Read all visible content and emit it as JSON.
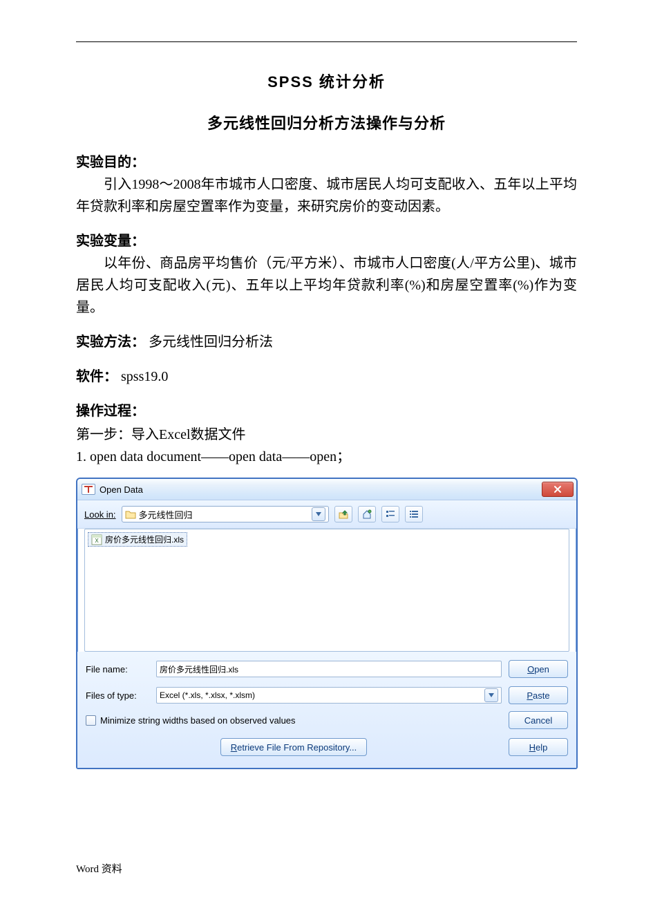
{
  "doc": {
    "title": "SPSS   统计分析",
    "subtitle": "多元线性回归分析方法操作与分析",
    "sections": {
      "purpose_h": "实验目的：",
      "purpose_body": "引入1998～2008年市城市人口密度、城市居民人均可支配收入、五年以上平均年贷款利率和房屋空置率作为变量，来研究房价的变动因素。",
      "vars_h": "实验变量：",
      "vars_body": "以年份、商品房平均售价（元/平方米）、市城市人口密度(人/平方公里)、城市居民人均可支配收入(元)、五年以上平均年贷款利率(%)和房屋空置率(%)作为变量。",
      "method_h": "实验方法：",
      "method_body": "多元线性回归分析法",
      "software_h": "软件：",
      "software_body": "spss19.0",
      "process_h": "操作过程：",
      "step1": "第一步：导入Excel数据文件",
      "step1_item": "1.  open data document——open data——open；"
    },
    "footer": "Word 资料"
  },
  "dialog": {
    "title": "Open Data",
    "lookin_label": "Look in:",
    "lookin_folder": "多元线性回归",
    "file_selected": "房价多元线性回归.xls",
    "filename_label": "File name:",
    "filename_value": "房价多元线性回归.xls",
    "filetype_label": "Files of type:",
    "filetype_value": "Excel (*.xls, *.xlsx, *.xlsm)",
    "checkbox_label": "Minimize string widths based on observed values",
    "buttons": {
      "open_pre": "O",
      "open_rest": "pen",
      "paste_pre": "P",
      "paste_rest": "aste",
      "cancel": "Cancel",
      "help_pre": "H",
      "help_rest": "elp",
      "repo_pre": "R",
      "repo_rest": "etrieve File From Repository..."
    }
  }
}
